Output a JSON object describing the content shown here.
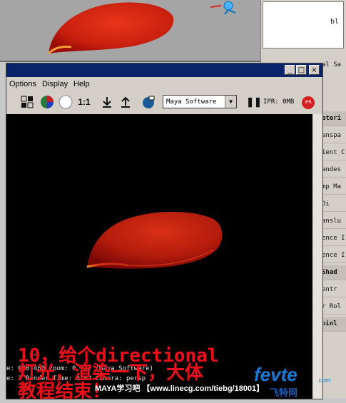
{
  "right_panel": {
    "top_value": "bl",
    "top_right_fragment": "al Sa",
    "items": [
      {
        "label": "ateri",
        "type": "hdr"
      },
      {
        "label": "anspa",
        "type": "item"
      },
      {
        "label": "ient C",
        "type": "item"
      },
      {
        "label": "andes",
        "type": "item"
      },
      {
        "label": "mp Ma",
        "type": "item"
      },
      {
        "label": "Di",
        "type": "item"
      },
      {
        "label": "anslu",
        "type": "item"
      },
      {
        "label": "ence I",
        "type": "item"
      },
      {
        "label": "ence I",
        "type": "item"
      },
      {
        "label": "Shad",
        "type": "hdr"
      },
      {
        "label": "entr",
        "type": "item"
      },
      {
        "label": "r Rol",
        "type": "item"
      },
      {
        "label": "pinl",
        "type": "hdr"
      }
    ]
  },
  "render_window": {
    "menu": [
      "Options",
      "Display",
      "Help"
    ],
    "title_buttons": [
      "_",
      "□",
      "×"
    ],
    "toolbar": {
      "ratio_label": "1:1",
      "renderer": "Maya Software",
      "ipr_status": "IPR: 0MB",
      "ipr_button": "IPR"
    },
    "status_line1": "e: 640 480 zoom: 0.722 (Maya Software)",
    "status_line2": "e: 1 Render Time: 0:02 Camera: persp"
  },
  "overlay": {
    "line1": "10，给个directional",
    "line2": "灯光，渲染一下，大体",
    "line3": "教程结束！"
  },
  "watermark": "MAYA学习吧 【www.lineсg.com/tiebg/18001】",
  "logo": {
    "text": "fevte",
    "domain": ".com",
    "cn": "飞特网"
  },
  "colors": {
    "petal_dark": "#8c0a08",
    "petal_mid": "#d42a14",
    "petal_edge": "#f0a030",
    "overlay_red": "#e8101a",
    "titlebar": "#0a246a"
  }
}
